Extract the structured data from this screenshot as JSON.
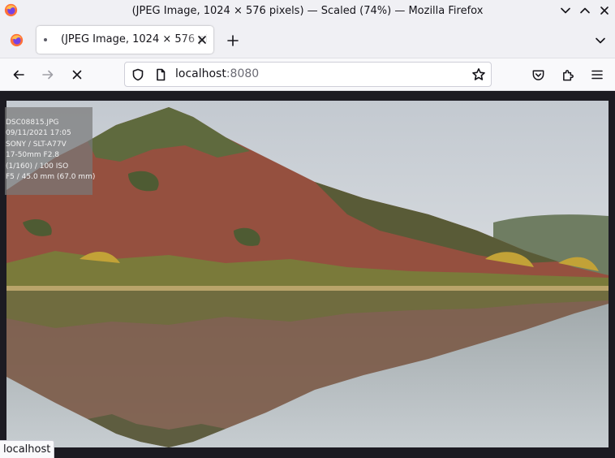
{
  "window": {
    "title": "(JPEG Image, 1024 × 576 pixels) — Scaled (74%) — Mozilla Firefox"
  },
  "tabs": [
    {
      "title": "(JPEG Image, 1024 × 576 pixels)",
      "active": true
    }
  ],
  "navbar": {
    "url_host": "localhost",
    "url_port": ":8080"
  },
  "image_overlay": {
    "lines": [
      "DSC08815.JPG",
      "09/11/2021 17:05",
      "SONY / SLT-A77V",
      "17-50mm F2.8",
      "(1/160) / 100 ISO",
      "F5 / 45.0 mm (67.0 mm)"
    ]
  },
  "status": {
    "text": "localhost"
  },
  "icons": {
    "app": "firefox-icon",
    "minimize": "chevron-down-icon",
    "maximize": "chevron-up-icon",
    "close": "close-icon",
    "back": "back-arrow-icon",
    "forward": "forward-arrow-icon",
    "stop": "stop-icon",
    "shield": "shield-icon",
    "page": "page-icon",
    "bookmark": "star-icon",
    "pocket": "pocket-icon",
    "extensions": "puzzle-icon",
    "menu": "hamburger-menu-icon"
  },
  "colors": {
    "chrome": "#f0f0f4",
    "content_bg": "#1c1b22",
    "accent": "#ff7139"
  }
}
